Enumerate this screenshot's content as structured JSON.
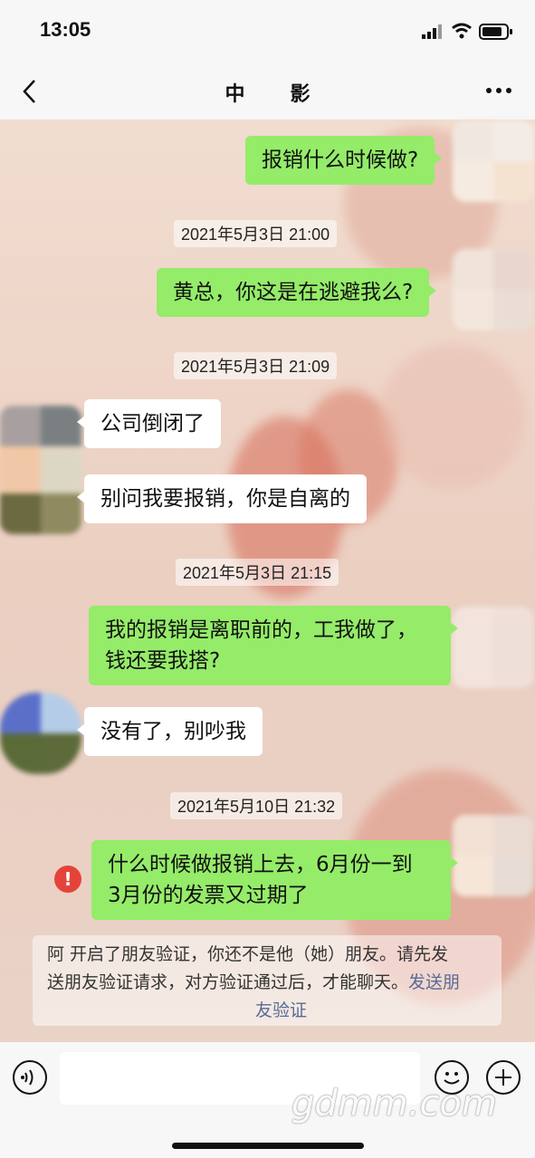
{
  "status_bar": {
    "time": "13:05"
  },
  "nav": {
    "title": "中影"
  },
  "messages": [
    {
      "side": "me",
      "text": "报销什么时候做?"
    },
    {
      "timestamp": "2021年5月3日 21:00"
    },
    {
      "side": "me",
      "text": "黄总，你这是在逃避我么?"
    },
    {
      "timestamp": "2021年5月3日 21:09"
    },
    {
      "side": "them",
      "text": "公司倒闭了"
    },
    {
      "side": "them",
      "text": "别问我要报销，你是自离的"
    },
    {
      "timestamp": "2021年5月3日 21:15"
    },
    {
      "side": "me",
      "line1": "我的报销是离职前的，工我做了，",
      "line2": "钱还要我搭?"
    },
    {
      "side": "them",
      "text": "没有了，别吵我"
    },
    {
      "timestamp": "2021年5月10日 21:32"
    },
    {
      "side": "me",
      "line1": "什么时候做报销上去，6月份一到",
      "line2": "3月份的发票又过期了",
      "status": "failed"
    }
  ],
  "notice": {
    "line1": "阿  开启了朋友验证，你还不是他（她）朋友。请先发",
    "line2": "送朋友验证请求，对方验证通过后，才能聊天。",
    "link_part1": "发送朋",
    "link_part2": "友验证"
  },
  "failed_icon": "!",
  "watermark": "gdmm.com",
  "colors": {
    "my_bubble": "#95ec69",
    "their_bubble": "#ffffff",
    "error": "#e5433a",
    "link": "#576b95"
  }
}
